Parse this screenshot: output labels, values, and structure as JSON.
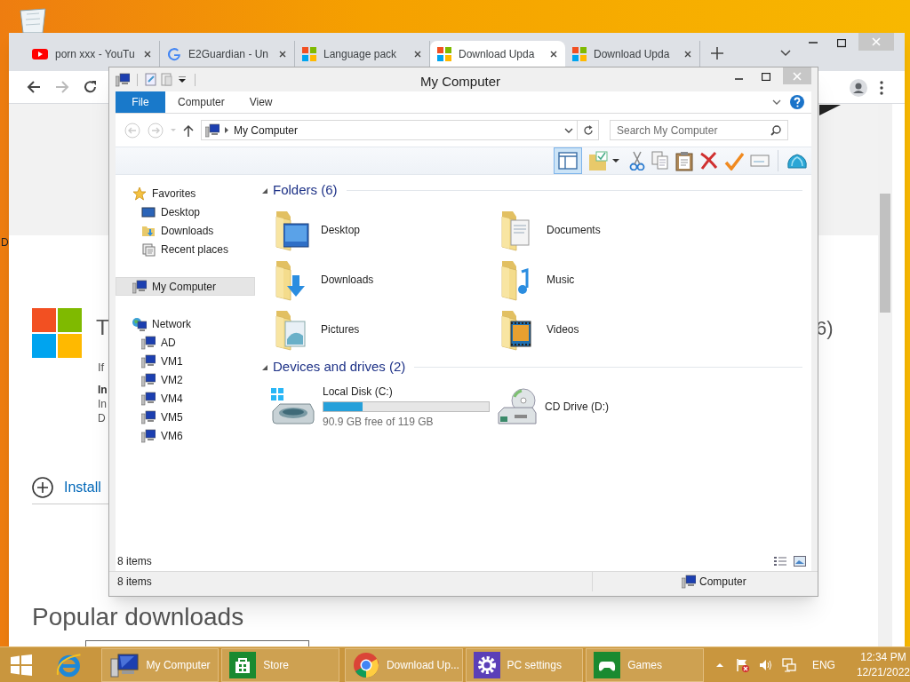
{
  "browser": {
    "tabs": [
      {
        "title": "porn xxx - YouTu",
        "kind": "youtube",
        "selected": false
      },
      {
        "title": "E2Guardian - Un",
        "kind": "google",
        "selected": false
      },
      {
        "title": "Language pack",
        "kind": "windows",
        "selected": false
      },
      {
        "title": "Download Upda",
        "kind": "windows",
        "selected": true
      },
      {
        "title": "Download Upda",
        "kind": "windows",
        "selected": false
      }
    ]
  },
  "page": {
    "edge_text": "D",
    "heading_start": "T",
    "heading_end": "6)",
    "line_1": "If",
    "line_2": "In",
    "line_3": "In",
    "line_4": "D",
    "install": "Install",
    "popular": "Popular downloads"
  },
  "explorer": {
    "title": "My Computer",
    "ribbon_tabs": [
      {
        "label": "File",
        "kind": "file"
      },
      {
        "label": "Computer",
        "kind": "tab"
      },
      {
        "label": "View",
        "kind": "tab"
      }
    ],
    "address": "My Computer",
    "search": {
      "placeholder": "Search My Computer"
    },
    "layout_toggle": {
      "on": true
    },
    "nav": [
      {
        "label": "Favorites",
        "kind": "favorites",
        "selected": false,
        "children": [
          {
            "label": "Desktop",
            "kind": "desktop",
            "selected": false
          },
          {
            "label": "Downloads",
            "kind": "downloads",
            "selected": false
          },
          {
            "label": "Recent places",
            "kind": "recent",
            "selected": false
          }
        ]
      },
      {
        "label": "My Computer",
        "kind": "computer",
        "selected": true
      },
      {
        "label": "Network",
        "kind": "network",
        "selected": false,
        "children": [
          {
            "label": "AD",
            "kind": "host",
            "selected": false
          },
          {
            "label": "VM1",
            "kind": "host",
            "selected": false
          },
          {
            "label": "VM2",
            "kind": "host",
            "selected": false
          },
          {
            "label": "VM4",
            "kind": "host",
            "selected": false
          },
          {
            "label": "VM5",
            "kind": "host",
            "selected": false
          },
          {
            "label": "VM6",
            "kind": "host",
            "selected": false
          }
        ]
      }
    ],
    "groups": [
      {
        "title": "Folders (6)",
        "items": [
          {
            "label": "Desktop",
            "kind": "desktop"
          },
          {
            "label": "Documents",
            "kind": "documents"
          },
          {
            "label": "Downloads",
            "kind": "downloads"
          },
          {
            "label": "Music",
            "kind": "music"
          },
          {
            "label": "Pictures",
            "kind": "pictures"
          },
          {
            "label": "Videos",
            "kind": "videos"
          }
        ]
      },
      {
        "title": "Devices and drives (2)",
        "items": [
          {
            "label": "Local Disk (C:)",
            "kind": "disk",
            "level": 0.236,
            "detail": "90.9 GB free of 119 GB"
          },
          {
            "label": "CD Drive (D:)",
            "kind": "cd"
          }
        ]
      }
    ],
    "item_count": "8 items",
    "status_bar": {
      "left": "8 items",
      "right": "Computer"
    }
  },
  "taskbar": {
    "buttons": [
      {
        "label": "My Computer",
        "kind": "explorer"
      },
      {
        "label": "Store",
        "kind": "store"
      },
      {
        "label": "Download Up...",
        "kind": "chrome"
      },
      {
        "label": "PC settings",
        "kind": "settings"
      },
      {
        "label": "Games",
        "kind": "games"
      }
    ],
    "language": "ENG",
    "time": "12:34 PM",
    "date": "12/21/2022"
  }
}
